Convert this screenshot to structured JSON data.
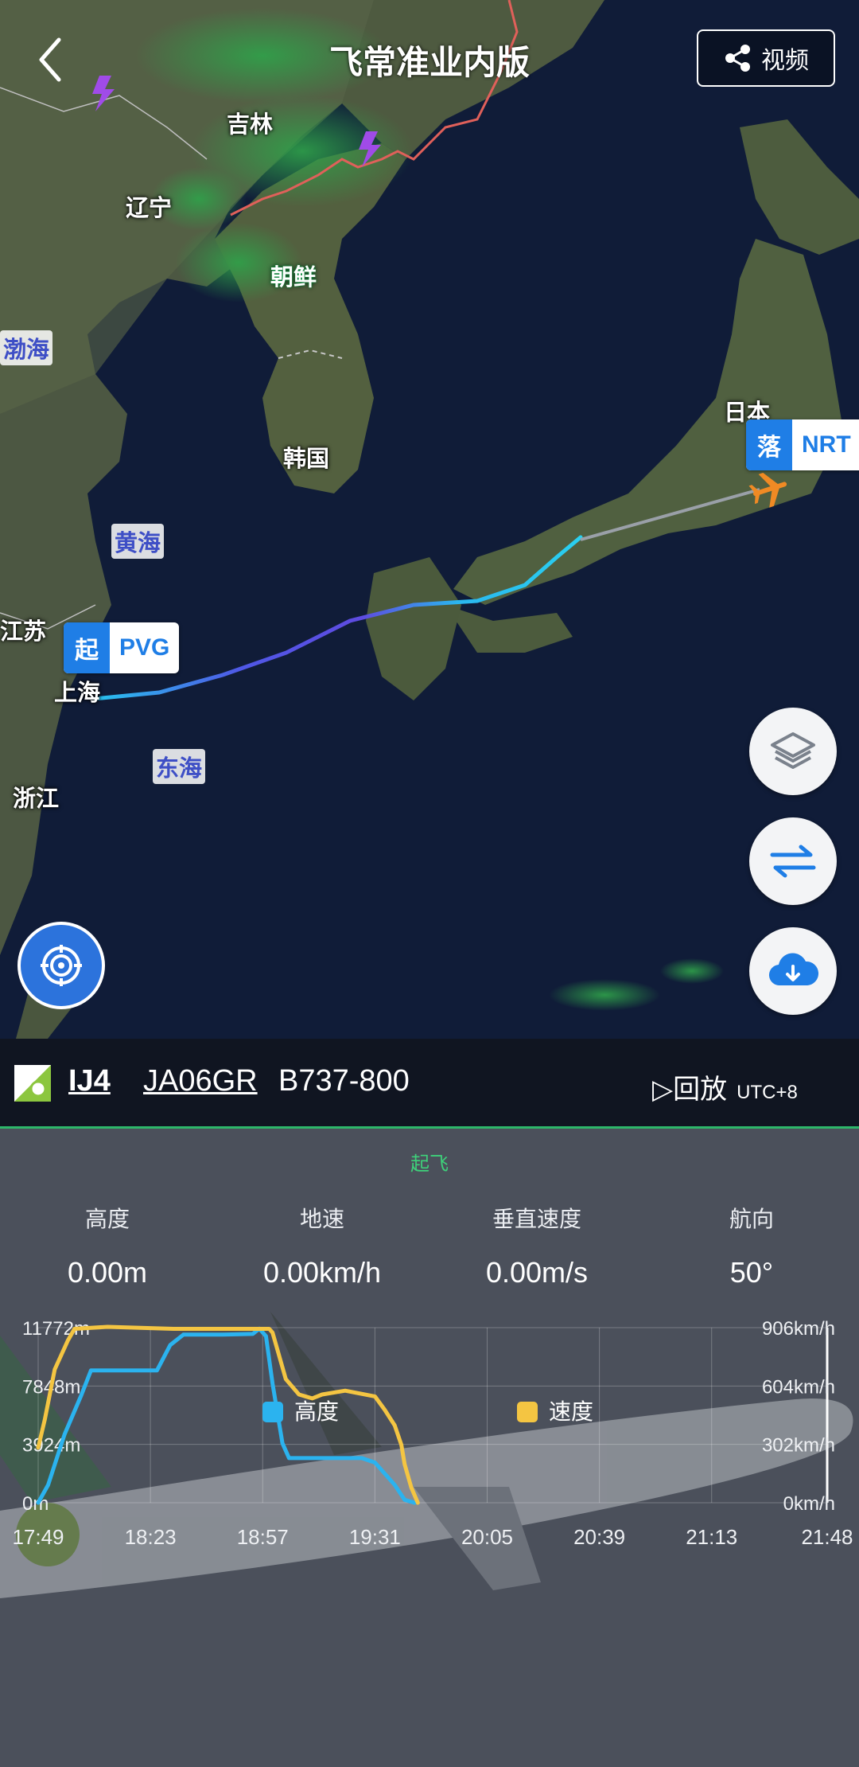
{
  "header": {
    "title": "飞常准业内版",
    "video_label": "视频"
  },
  "map": {
    "labels": {
      "jilin": "吉林",
      "liaoning": "辽宁",
      "chaoxian": "朝鲜",
      "hanguo": "韩国",
      "riben": "日本",
      "shanghai": "上海",
      "jiangsu": "江苏",
      "zhejiang": "浙江"
    },
    "seas": {
      "bohai": "渤海",
      "huanghai": "黄海",
      "donghai": "东海"
    },
    "origin": {
      "badge": "起",
      "code": "PVG"
    },
    "destination": {
      "badge": "落",
      "code": "NRT"
    }
  },
  "flight": {
    "flight_no": "IJ4",
    "registration": "JA06GR",
    "aircraft": "B737-800",
    "replay_label": "▷回放",
    "timezone": "UTC+8"
  },
  "panel": {
    "phase": "起飞",
    "stats": [
      {
        "label": "高度",
        "value": "0.00m"
      },
      {
        "label": "地速",
        "value": "0.00km/h"
      },
      {
        "label": "垂直速度",
        "value": "0.00m/s"
      },
      {
        "label": "航向",
        "value": "50°"
      }
    ]
  },
  "colors": {
    "altitude": "#2bb3ef",
    "speed": "#f4c542",
    "accent": "#1f7ee6",
    "phase": "#3ed07a"
  },
  "chart_data": {
    "type": "line",
    "x_ticks": [
      "17:49",
      "18:23",
      "18:57",
      "19:31",
      "20:05",
      "20:39",
      "21:13",
      "21:48"
    ],
    "y_left_ticks": [
      "0m",
      "3924m",
      "7848m",
      "11772m"
    ],
    "y_right_ticks": [
      "0km/h",
      "302km/h",
      "604km/h",
      "906km/h"
    ],
    "ylim_left": [
      0,
      11772
    ],
    "ylim_right": [
      0,
      906
    ],
    "series": [
      {
        "name": "高度",
        "unit": "m",
        "axis": "left",
        "color": "#2bb3ef",
        "points": [
          [
            "17:49",
            0
          ],
          [
            "17:52",
            1200
          ],
          [
            "17:57",
            4600
          ],
          [
            "18:02",
            7200
          ],
          [
            "18:05",
            8900
          ],
          [
            "18:13",
            8900
          ],
          [
            "18:20",
            8900
          ],
          [
            "18:25",
            8900
          ],
          [
            "18:29",
            10600
          ],
          [
            "18:33",
            11300
          ],
          [
            "18:45",
            11300
          ],
          [
            "18:54",
            11350
          ],
          [
            "18:56",
            11700
          ],
          [
            "18:58",
            11200
          ],
          [
            "19:00",
            8000
          ],
          [
            "19:03",
            4000
          ],
          [
            "19:05",
            3000
          ],
          [
            "19:10",
            3000
          ],
          [
            "19:20",
            3000
          ],
          [
            "19:27",
            3000
          ],
          [
            "19:31",
            2700
          ],
          [
            "19:37",
            1200
          ],
          [
            "19:40",
            200
          ],
          [
            "19:43",
            0
          ]
        ]
      },
      {
        "name": "速度",
        "unit": "km/h",
        "axis": "right",
        "color": "#f4c542",
        "points": [
          [
            "17:49",
            285
          ],
          [
            "17:51",
            430
          ],
          [
            "17:54",
            690
          ],
          [
            "17:58",
            840
          ],
          [
            "18:00",
            900
          ],
          [
            "18:10",
            910
          ],
          [
            "18:30",
            900
          ],
          [
            "18:50",
            900
          ],
          [
            "18:59",
            900
          ],
          [
            "19:00",
            880
          ],
          [
            "19:04",
            640
          ],
          [
            "19:08",
            560
          ],
          [
            "19:12",
            540
          ],
          [
            "19:15",
            560
          ],
          [
            "19:22",
            580
          ],
          [
            "19:31",
            550
          ],
          [
            "19:34",
            480
          ],
          [
            "19:37",
            400
          ],
          [
            "19:39",
            300
          ],
          [
            "19:40",
            200
          ],
          [
            "19:42",
            80
          ],
          [
            "19:44",
            0
          ]
        ]
      }
    ]
  }
}
